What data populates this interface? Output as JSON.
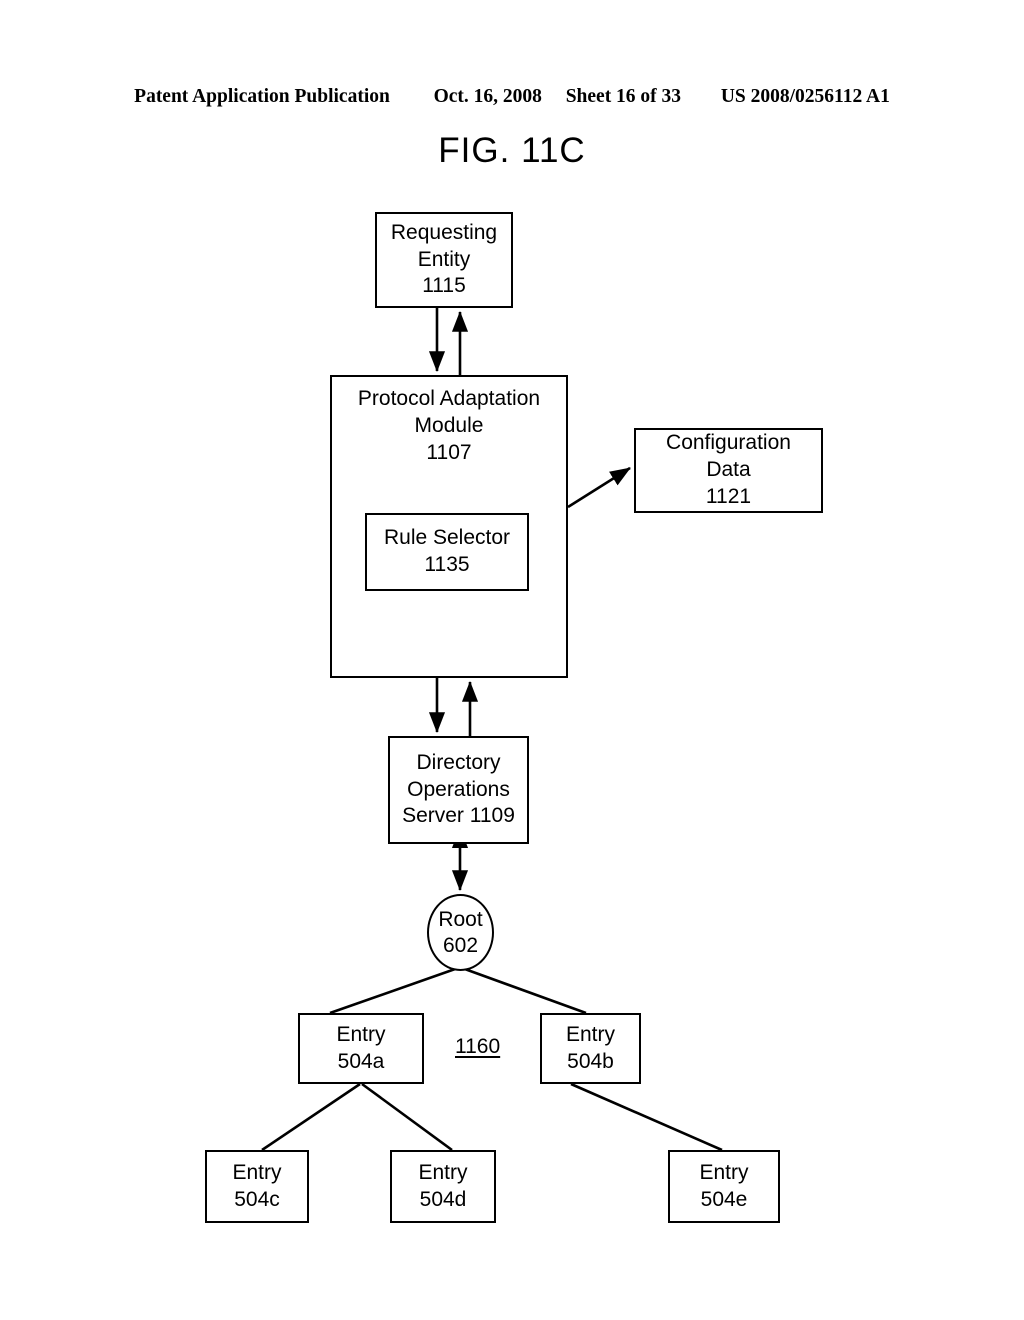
{
  "header": {
    "publication": "Patent Application Publication",
    "date": "Oct. 16, 2008",
    "sheet": "Sheet 16 of 33",
    "patent_number": "US 2008/0256112 A1"
  },
  "figure": {
    "title": "FIG. 11C",
    "reference_label": "1160"
  },
  "nodes": {
    "requesting_entity": {
      "line1": "Requesting",
      "line2": "Entity",
      "line3": "1115"
    },
    "protocol_adaptation_module": {
      "line1": "Protocol Adaptation",
      "line2": "Module",
      "line3": "1107"
    },
    "rule_selector": {
      "line1": "Rule Selector",
      "line2": "1135"
    },
    "configuration_data": {
      "line1": "Configuration",
      "line2": "Data",
      "line3": "1121"
    },
    "directory_operations_server": {
      "line1": "Directory",
      "line2": "Operations",
      "line3": "Server 1109"
    },
    "root": {
      "line1": "Root",
      "line2": "602"
    },
    "entry_504a": {
      "line1": "Entry",
      "line2": "504a"
    },
    "entry_504b": {
      "line1": "Entry",
      "line2": "504b"
    },
    "entry_504c": {
      "line1": "Entry",
      "line2": "504c"
    },
    "entry_504d": {
      "line1": "Entry",
      "line2": "504d"
    },
    "entry_504e": {
      "line1": "Entry",
      "line2": "504e"
    }
  },
  "colors": {
    "stroke": "#000000",
    "background": "#ffffff"
  }
}
